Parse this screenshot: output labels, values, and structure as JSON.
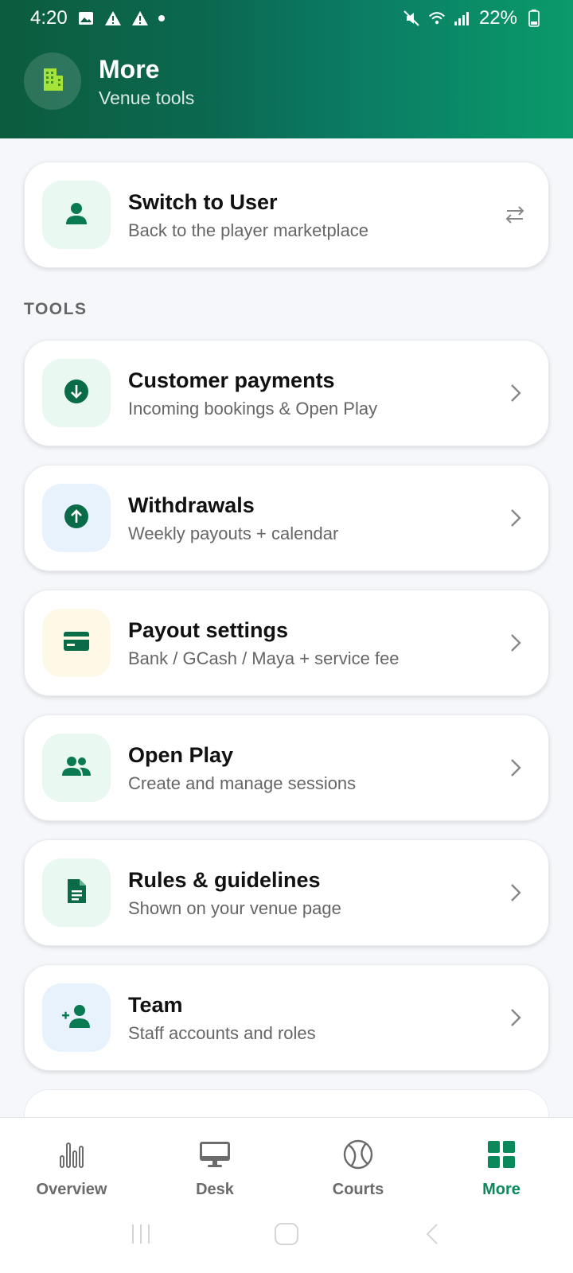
{
  "status_bar": {
    "time": "4:20",
    "battery": "22%"
  },
  "header": {
    "title": "More",
    "subtitle": "Venue tools"
  },
  "switch_card": {
    "title": "Switch to User",
    "subtitle": "Back to the player marketplace"
  },
  "section": {
    "tools_label": "TOOLS"
  },
  "tools": [
    {
      "title": "Customer payments",
      "subtitle": "Incoming bookings & Open Play"
    },
    {
      "title": "Withdrawals",
      "subtitle": "Weekly payouts + calendar"
    },
    {
      "title": "Payout settings",
      "subtitle": "Bank / GCash / Maya + service fee"
    },
    {
      "title": "Open Play",
      "subtitle": "Create and manage sessions"
    },
    {
      "title": "Rules & guidelines",
      "subtitle": "Shown on your venue page"
    },
    {
      "title": "Team",
      "subtitle": "Staff accounts and roles"
    }
  ],
  "nav": {
    "overview": "Overview",
    "desk": "Desk",
    "courts": "Courts",
    "more": "More"
  },
  "colors": {
    "brand": "#0a8a5a",
    "header_start": "#0c5c3e",
    "header_end": "#0a9a6a"
  }
}
